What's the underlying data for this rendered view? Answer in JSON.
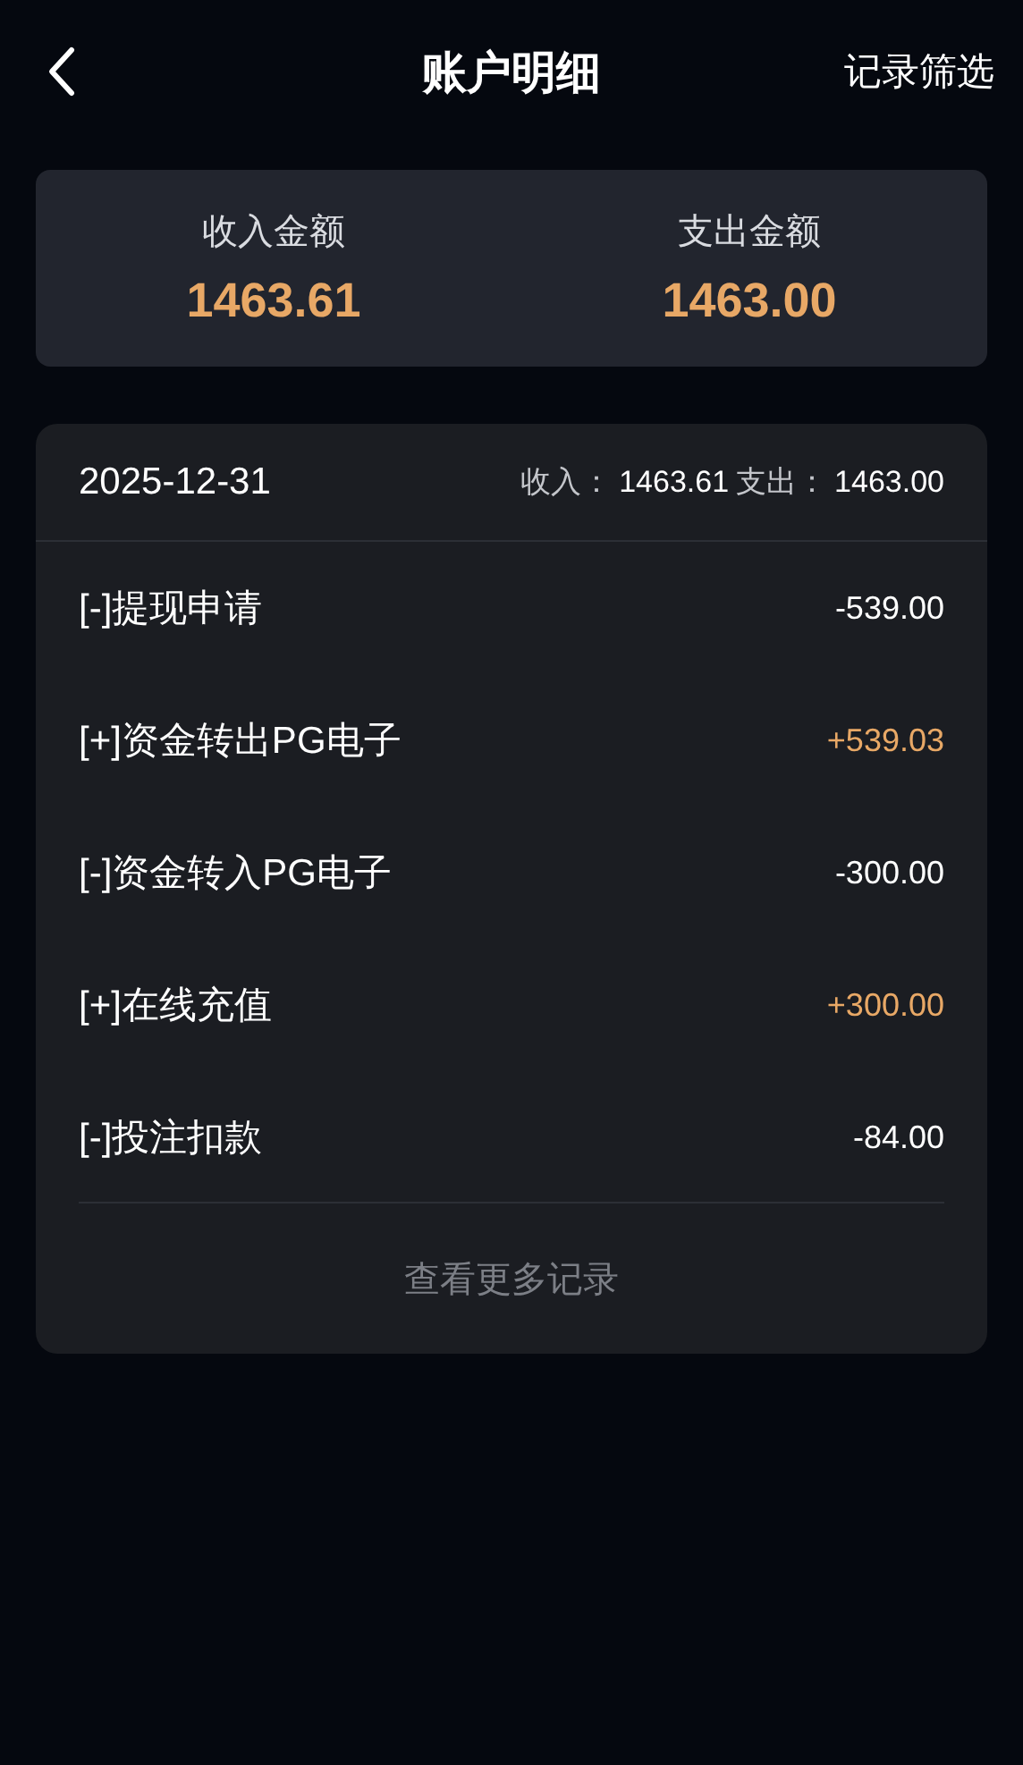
{
  "header": {
    "title": "账户明细",
    "action": "记录筛选"
  },
  "summary": [
    {
      "label": "收入金额",
      "amount": "1463.61"
    },
    {
      "label": "支出金额",
      "amount": "1463.00"
    }
  ],
  "day": {
    "date": "2025-12-31",
    "totals": [
      {
        "label": "收入：",
        "value": "1463.61"
      },
      {
        "label": "支出：",
        "value": "1463.00"
      }
    ],
    "records": [
      {
        "title": "[-]提现申请",
        "amount": "-539.00",
        "kind": "expense"
      },
      {
        "title": "[+]资金转出PG电子",
        "amount": "+539.03",
        "kind": "income"
      },
      {
        "title": "[-]资金转入PG电子",
        "amount": "-300.00",
        "kind": "expense"
      },
      {
        "title": "[+]在线充值",
        "amount": "+300.00",
        "kind": "income"
      },
      {
        "title": "[-]投注扣款",
        "amount": "-84.00",
        "kind": "expense"
      }
    ],
    "more": "查看更多记录"
  }
}
